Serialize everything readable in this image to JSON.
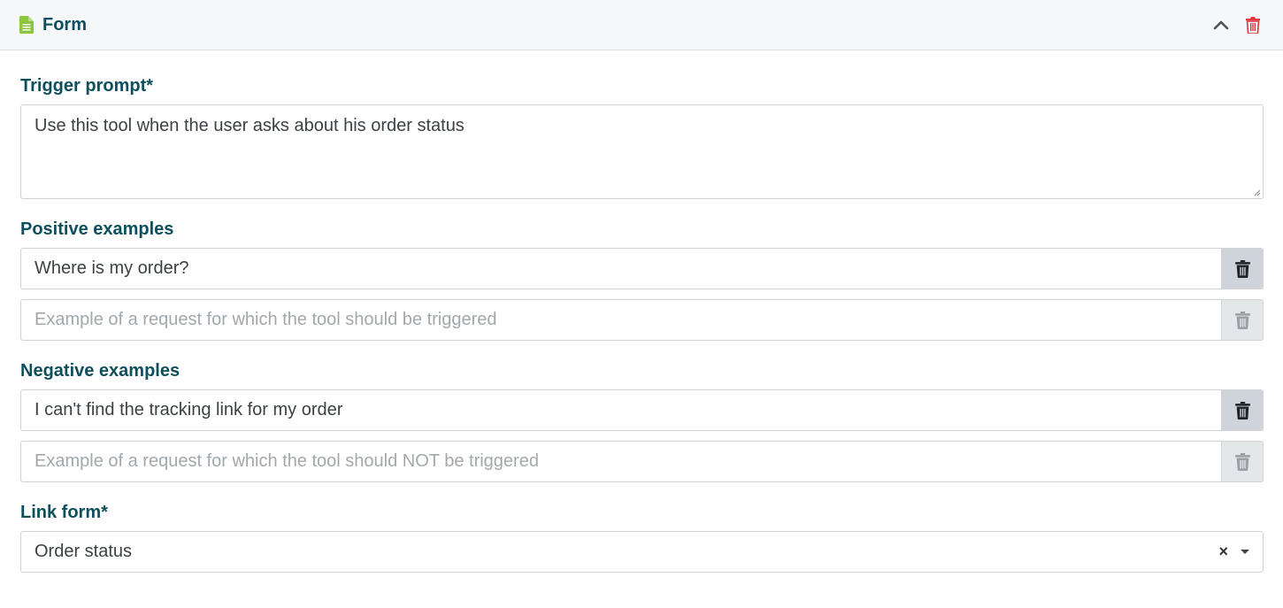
{
  "header": {
    "title": "Form",
    "icon": "document-icon",
    "collapse_icon": "chevron-up-icon",
    "delete_icon": "trash-icon",
    "accent_color": "#8cc63f",
    "delete_color": "#e0383e"
  },
  "trigger": {
    "label": "Trigger prompt*",
    "value": "Use this tool when the user asks about his order status"
  },
  "positive": {
    "label": "Positive examples",
    "items": [
      {
        "value": "Where is my order?",
        "placeholder": ""
      },
      {
        "value": "",
        "placeholder": "Example of a request for which the tool should be triggered"
      }
    ]
  },
  "negative": {
    "label": "Negative examples",
    "items": [
      {
        "value": "I can't find the tracking link for my order",
        "placeholder": ""
      },
      {
        "value": "",
        "placeholder": "Example of a request for which the tool should NOT be triggered"
      }
    ]
  },
  "link_form": {
    "label": "Link form*",
    "selected": "Order status",
    "clear_symbol": "×"
  }
}
